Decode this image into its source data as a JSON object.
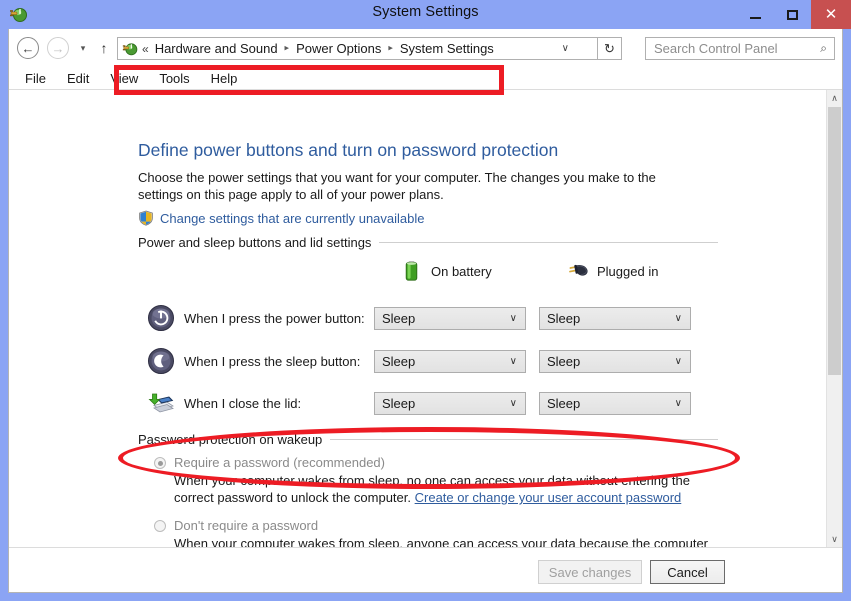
{
  "window": {
    "title": "System Settings",
    "icon": "power-options-icon",
    "minimize_label": "–",
    "maximize_label": "□",
    "close_label": "✕",
    "accent_title_bg": "#8ba4f4",
    "close_bg": "#c75050"
  },
  "navbar": {
    "back_label": "←",
    "forward_label": "→",
    "recent_label": "▾",
    "up_label": "↑",
    "address": {
      "prefix": "«",
      "crumbs": [
        "Hardware and Sound",
        "Power Options",
        "System Settings"
      ],
      "separator": "▸",
      "dropdown_label": "∨"
    },
    "refresh_label": "↻",
    "search": {
      "placeholder": "Search Control Panel",
      "icon_label": "⌕"
    }
  },
  "menubar": {
    "items": [
      "File",
      "Edit",
      "View",
      "Tools",
      "Help"
    ]
  },
  "content": {
    "heading": "Define power buttons and turn on password protection",
    "subtext": "Choose the power settings that you want for your computer. The changes you make to the settings on this page apply to all of your power plans.",
    "uac_link": "Change settings that are currently unavailable",
    "sections": {
      "power": "Power and sleep buttons and lid settings",
      "password": "Password protection on wakeup"
    },
    "columns": [
      {
        "label": "On battery",
        "icon": "battery-icon"
      },
      {
        "label": "Plugged in",
        "icon": "power-plug-icon"
      }
    ],
    "rows": [
      {
        "label": "When I press the power button:",
        "icon": "power-button-icon",
        "battery": "Sleep",
        "plugged": "Sleep"
      },
      {
        "label": "When I press the sleep button:",
        "icon": "sleep-button-icon",
        "battery": "Sleep",
        "plugged": "Sleep"
      },
      {
        "label": "When I close the lid:",
        "icon": "laptop-lid-icon",
        "battery": "Sleep",
        "plugged": "Sleep"
      }
    ],
    "combo_chevron": "∨",
    "password_options": [
      {
        "label": "Require a password (recommended)",
        "checked": true,
        "desc_before": "When your computer wakes from sleep, no one can access your data without entering the correct password to unlock the computer. ",
        "link": "Create or change your user account password",
        "desc_after": ""
      },
      {
        "label": "Don't require a password",
        "checked": false,
        "desc_before": "When your computer wakes from sleep, anyone can access your data because the computer isn't locked.",
        "link": "",
        "desc_after": ""
      }
    ]
  },
  "scrollbar": {
    "up_label": "∧",
    "down_label": "∨"
  },
  "footer": {
    "save_label": "Save changes",
    "cancel_label": "Cancel"
  },
  "annotations": {
    "color": "#ed1c24",
    "rect_target": "address-breadcrumb",
    "ellipse_target": "when-i-close-the-lid-row"
  }
}
